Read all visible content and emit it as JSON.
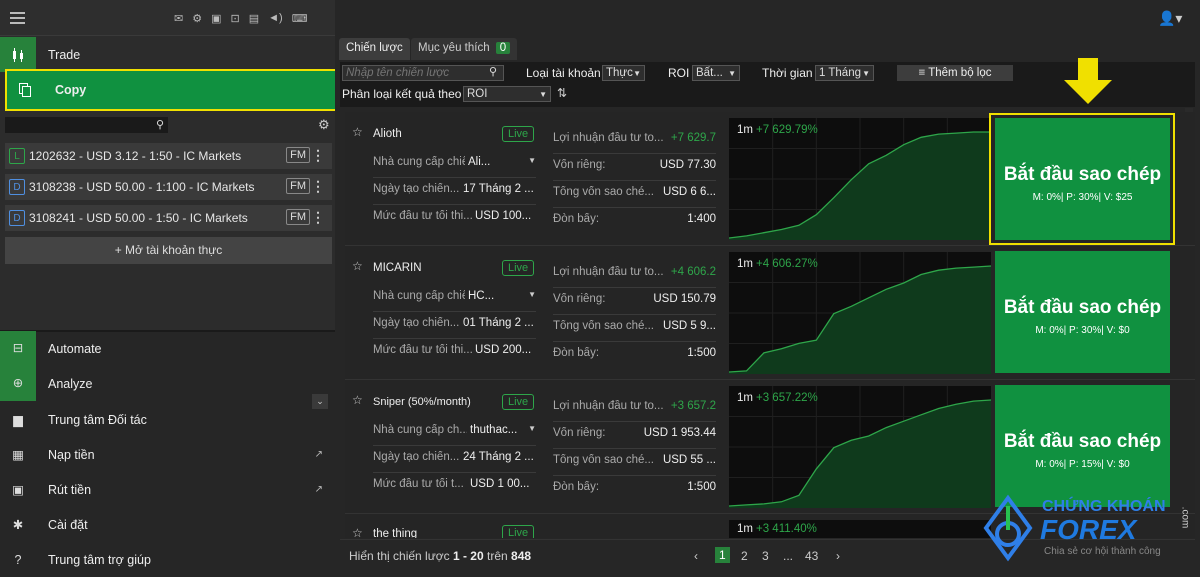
{
  "sidebar": {
    "nav": [
      {
        "label": "Trade"
      },
      {
        "label": "Copy"
      }
    ],
    "accounts": [
      {
        "type": "L",
        "type_color": "#2ea64a",
        "label": "1202632 - USD 3.12 - 1:50 - IC Markets",
        "badge": "FM"
      },
      {
        "type": "D",
        "type_color": "#4f8fe0",
        "label": "3108238 - USD 50.00 - 1:100 - IC Markets",
        "badge": "FM"
      },
      {
        "type": "D",
        "type_color": "#4f8fe0",
        "label": "3108241 - USD 50.00 - 1:50 - IC Markets",
        "badge": "FM"
      }
    ],
    "open_account": "+ Mở tài khoản thực",
    "lower": [
      {
        "label": "Automate",
        "icon": "robot-icon"
      },
      {
        "label": "Analyze",
        "icon": "analyze-icon"
      },
      {
        "label": "Trung tâm Đối tác",
        "icon": "briefcase-icon"
      },
      {
        "label": "Nạp tiền",
        "icon": "deposit-icon"
      },
      {
        "label": "Rút tiền",
        "icon": "wallet-icon"
      },
      {
        "label": "Cài đặt",
        "icon": "gear-icon"
      },
      {
        "label": "Trung tâm trợ giúp",
        "icon": "help-icon"
      }
    ]
  },
  "tabs": {
    "strategies": "Chiến lược",
    "favorites": "Mục yêu thích",
    "favorites_count": "0"
  },
  "filters": {
    "search_placeholder": "Nhập tên chiến lược",
    "account_type_label": "Loại tài khoản",
    "account_type_value": "Thực",
    "roi_label": "ROI",
    "roi_value": "Bất...",
    "time_label": "Thời gian",
    "time_value": "1 Tháng",
    "add_filter": "Thêm bộ lọc",
    "sort_label": "Phân loại kết quả theo",
    "sort_value": "ROI"
  },
  "strategies": [
    {
      "name": "Alioth",
      "status": "Live",
      "provider_label": "Nhà cung cấp chiến l...",
      "provider": "Ali...",
      "created_label": "Ngày tạo chiến...",
      "created": "17 Tháng 2 ...",
      "min_label": "Mức đầu tư tối thi...",
      "min": "USD 100...",
      "profit_label": "Lợi nhuận đầu tư to...",
      "profit": "+7 629.7",
      "equity_label": "Vốn riêng:",
      "equity": "USD 77.30",
      "total_label": "Tổng vốn sao ché...",
      "total": "USD 6 6...",
      "leverage_label": "Đòn bẩy:",
      "leverage": "1:400",
      "chart_label": "1m",
      "chart_value": "+7 629.79%",
      "chart_data": {
        "type": "area",
        "y": [
          0,
          2,
          5,
          8,
          12,
          22,
          38,
          55,
          70,
          78,
          88,
          95,
          98,
          99,
          100,
          100
        ]
      },
      "copy_title": "Bắt đầu sao chép",
      "copy_sub": "M: 0%| P: 30%| V: $25"
    },
    {
      "name": "MICARIN",
      "status": "Live",
      "provider_label": "Nhà cung cấp chiến l...",
      "provider": "HC...",
      "created_label": "Ngày tạo chiến...",
      "created": "01 Tháng 2 ...",
      "min_label": "Mức đầu tư tối thi...",
      "min": "USD 200...",
      "profit_label": "Lợi nhuận đầu tư to...",
      "profit": "+4 606.2",
      "equity_label": "Vốn riêng:",
      "equity": "USD 150.79",
      "total_label": "Tổng vốn sao ché...",
      "total": "USD 5 9...",
      "leverage_label": "Đòn bẩy:",
      "leverage": "1:500",
      "chart_label": "1m",
      "chart_value": "+4 606.27%",
      "chart_data": {
        "type": "area",
        "y": [
          0,
          1,
          18,
          22,
          27,
          30,
          55,
          62,
          70,
          78,
          84,
          92,
          96,
          98,
          99,
          100
        ]
      },
      "copy_title": "Bắt đầu sao chép",
      "copy_sub": "M: 0%| P: 30%| V: $0"
    },
    {
      "name": "Sniper (50%/month)",
      "status": "Live",
      "provider_label": "Nhà cung cấp ch...",
      "provider": "thuthac...",
      "created_label": "Ngày tạo chiến...",
      "created": "24 Tháng 2 ...",
      "min_label": "Mức đầu tư tối t...",
      "min": "USD 1 00...",
      "profit_label": "Lợi nhuận đầu tư to...",
      "profit": "+3 657.2",
      "equity_label": "Vốn riêng:",
      "equity": "USD 1 953.44",
      "total_label": "Tổng vốn sao ché...",
      "total": "USD 55 ...",
      "leverage_label": "Đòn bẩy:",
      "leverage": "1:500",
      "chart_label": "1m",
      "chart_value": "+3 657.22%",
      "chart_data": {
        "type": "area",
        "y": [
          0,
          1,
          2,
          4,
          10,
          35,
          55,
          62,
          66,
          74,
          80,
          86,
          92,
          96,
          99,
          100
        ]
      },
      "copy_title": "Bắt đầu sao chép",
      "copy_sub": "M: 0%| P: 15%| V: $0"
    },
    {
      "name": "the thing",
      "status": "Live",
      "chart_label": "1m",
      "chart_value": "+3 411.40%"
    }
  ],
  "pagination": {
    "prefix": "Hiển thị chiến lược",
    "range": "1 - 20",
    "of": "trên",
    "total": "848",
    "pages": [
      "1",
      "2",
      "3",
      "...",
      "43"
    ]
  },
  "watermark": {
    "brand_top": "CHỨNG KHOÁN",
    "brand_main": "FOREX",
    "domain": ".com",
    "tagline": "Chia sẻ cơ hội thành công"
  },
  "colors": {
    "accent": "#27823b",
    "copy_button": "#109140",
    "highlight": "#f0e000"
  }
}
